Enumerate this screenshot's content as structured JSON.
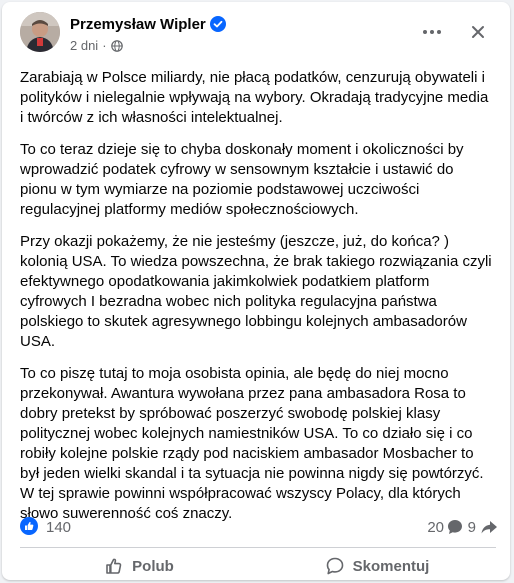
{
  "post": {
    "author": "Przemysław Wipler",
    "time": "2 dni",
    "paragraphs": [
      "Zarabiają w Polsce miliardy, nie płacą podatków, cenzurują obywateli i polityków i nielegalnie wpływają na wybory. Okradają tradycyjne media i twórców z ich własności intelektualnej.",
      "To co teraz dzieje się to chyba doskonały moment i okoliczności by wprowadzić  podatek cyfrowy w sensownym kształcie i ustawić do pionu w tym wymiarze na poziomie podstawowej uczciwości regulacyjnej platformy mediów społecznościowych.",
      "Przy okazji pokażemy, że nie jesteśmy (jeszcze, już, do końca? ) kolonią USA. To wiedza powszechna, że brak takiego rozwiązania czyli efektywnego opodatkowania jakimkolwiek podatkiem platform cyfrowych I bezradna wobec nich polityka regulacyjna państwa polskiego to skutek agresywnego lobbingu kolejnych ambasadorów USA.",
      "To co piszę tutaj to moja osobista opinia, ale będę do niej mocno przekonywał. Awantura wywołana przez pana ambasadora Rosa to dobry pretekst by spróbować poszerzyć swobodę polskiej klasy politycznej wobec kolejnych namiestników USA. To co działo się i co robiły kolejne polskie rządy pod naciskiem ambasador Mosbacher to był jeden wielki skandal i ta sytuacja nie powinna nigdy się powtórzyć. W tej sprawie powinni współpracować wszyscy Polacy, dla których słowo suwerenność coś znaczy."
    ]
  },
  "stats": {
    "likes": "140",
    "comments": "20",
    "shares": "9"
  },
  "actions": {
    "like_label": "Polub",
    "comment_label": "Skomentuj"
  },
  "colors": {
    "accent": "#0866ff",
    "muted": "#65676b"
  }
}
